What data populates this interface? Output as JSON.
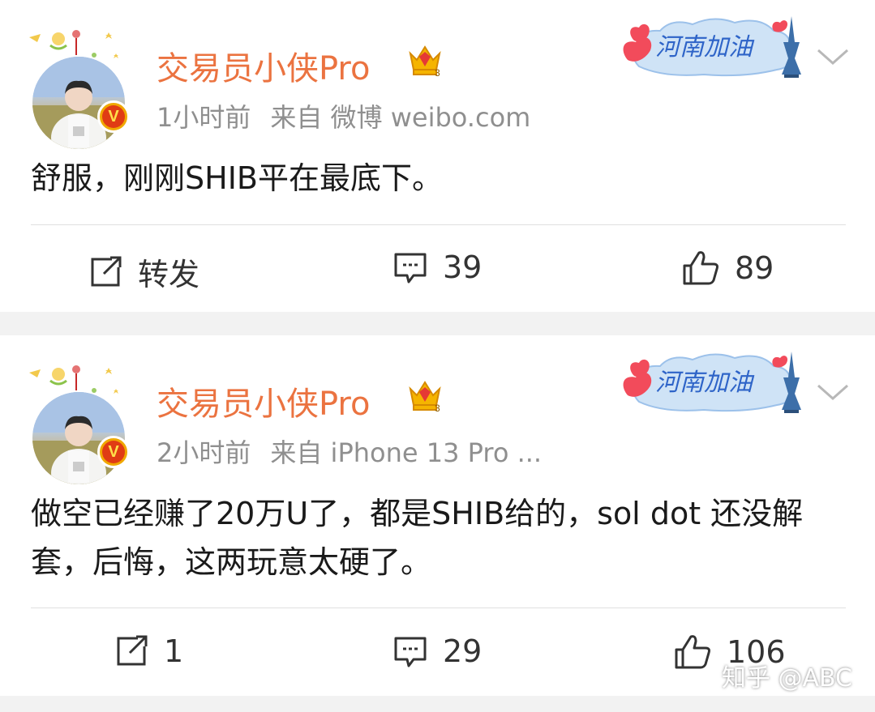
{
  "posts": [
    {
      "username": "交易员小侠Pro",
      "time": "1小时前",
      "source": "来自 微博 weibo.com",
      "content": "舒服，刚刚SHIB平在最底下。",
      "badge_text": "河南加油",
      "verified_glyph": "V",
      "actions": {
        "repost": "转发",
        "comments": "39",
        "likes": "89"
      }
    },
    {
      "username": "交易员小侠Pro",
      "time": "2小时前",
      "source": "来自 iPhone 13 Pro ...",
      "content": "做空已经赚了20万U了，都是SHIB给的，sol dot 还没解套，后悔，这两玩意太硬了。",
      "badge_text": "河南加油",
      "verified_glyph": "V",
      "actions": {
        "repost": "1",
        "comments": "29",
        "likes": "106"
      }
    }
  ],
  "watermark": "知乎 @ABC",
  "icons": [
    "repost-icon",
    "comment-icon",
    "like-icon",
    "chevron-down-icon",
    "crown-icon",
    "verified-icon"
  ],
  "colors": {
    "username": "#eb7340",
    "meta": "#8f8f8f",
    "text": "#1a1a1a",
    "background": "#f2f2f2"
  }
}
